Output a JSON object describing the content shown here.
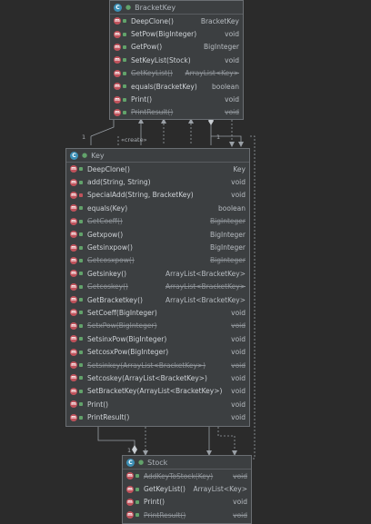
{
  "bracketkey": {
    "title": "BracketKey",
    "methods": [
      {
        "name": "DeepClone()",
        "type": "BracketKey",
        "dim": false
      },
      {
        "name": "SetPow(BigInteger)",
        "type": "void",
        "dim": false
      },
      {
        "name": "GetPow()",
        "type": "BigInteger",
        "dim": false
      },
      {
        "name": "SetKeyList(Stock)",
        "type": "void",
        "dim": false
      },
      {
        "name": "GetKeyList()",
        "type": "ArrayList<Key>",
        "dim": true
      },
      {
        "name": "equals(BracketKey)",
        "type": "boolean",
        "dim": false
      },
      {
        "name": "Print()",
        "type": "void",
        "dim": false
      },
      {
        "name": "PrintResult()",
        "type": "void",
        "dim": true
      }
    ]
  },
  "key": {
    "title": "Key",
    "methods": [
      {
        "name": "DeepClone()",
        "type": "Key",
        "dim": false
      },
      {
        "name": "add(String, String)",
        "type": "void",
        "dim": false
      },
      {
        "name": "SpecialAdd(String, BracketKey)",
        "type": "void",
        "dim": false,
        "priv": true
      },
      {
        "name": "equals(Key)",
        "type": "boolean",
        "dim": false
      },
      {
        "name": "GetCoeff()",
        "type": "BigInteger",
        "dim": true
      },
      {
        "name": "Getxpow()",
        "type": "BigInteger",
        "dim": false
      },
      {
        "name": "Getsinxpow()",
        "type": "BigInteger",
        "dim": false
      },
      {
        "name": "Getcosxpow()",
        "type": "BigInteger",
        "dim": true
      },
      {
        "name": "Getsinkey()",
        "type": "ArrayList<BracketKey>",
        "dim": false
      },
      {
        "name": "Getcoskey()",
        "type": "ArrayList<BracketKey>",
        "dim": true
      },
      {
        "name": "GetBracketkey()",
        "type": "ArrayList<BracketKey>",
        "dim": false
      },
      {
        "name": "SetCoeff(BigInteger)",
        "type": "void",
        "dim": false
      },
      {
        "name": "SetxPow(BigInteger)",
        "type": "void",
        "dim": true
      },
      {
        "name": "SetsinxPow(BigInteger)",
        "type": "void",
        "dim": false
      },
      {
        "name": "SetcosxPow(BigInteger)",
        "type": "void",
        "dim": false
      },
      {
        "name": "Setsinkey(ArrayList<BracketKey>)",
        "type": "void",
        "dim": true
      },
      {
        "name": "Setcoskey(ArrayList<BracketKey>)",
        "type": "void",
        "dim": false
      },
      {
        "name": "SetBracketKey(ArrayList<BracketKey>)",
        "type": "void",
        "dim": false
      },
      {
        "name": "Print()",
        "type": "void",
        "dim": false
      },
      {
        "name": "PrintResult()",
        "type": "void",
        "dim": false
      }
    ]
  },
  "stock": {
    "title": "Stock",
    "methods": [
      {
        "name": "AddKeyToStock(Key)",
        "type": "void",
        "dim": true
      },
      {
        "name": "GetKeyList()",
        "type": "ArrayList<Key>",
        "dim": false
      },
      {
        "name": "Print()",
        "type": "void",
        "dim": false
      },
      {
        "name": "PrintResult()",
        "type": "void",
        "dim": true
      }
    ]
  },
  "relations": {
    "create_label": "«create»",
    "mult_top_left": "1",
    "mult_top_right": "1",
    "mult_bottom": "1"
  }
}
